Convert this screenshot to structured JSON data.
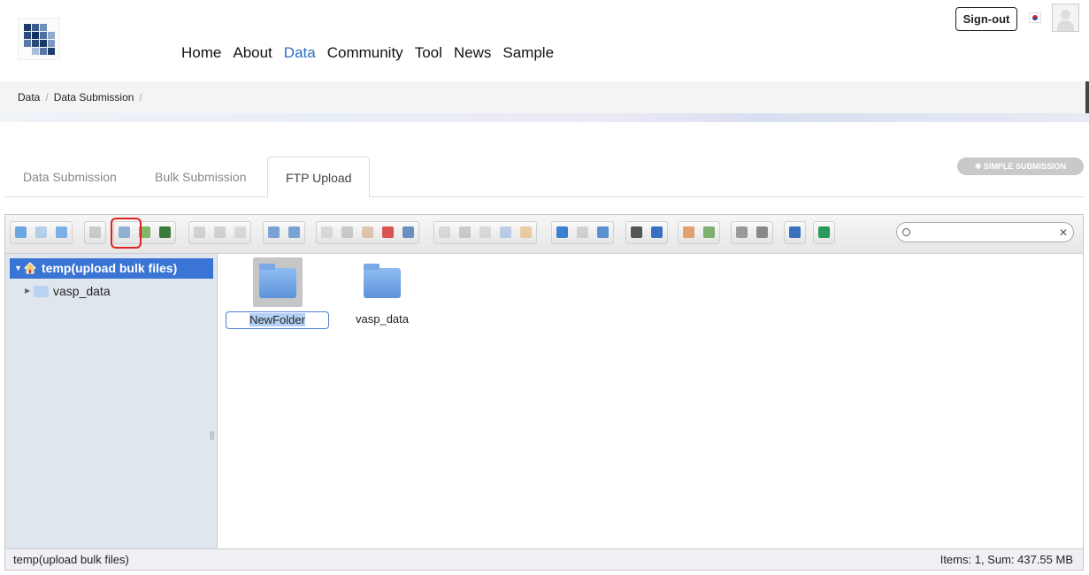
{
  "header": {
    "nav": [
      {
        "label": "Home",
        "active": false
      },
      {
        "label": "About",
        "active": false
      },
      {
        "label": "Data",
        "active": true
      },
      {
        "label": "Community",
        "active": false
      },
      {
        "label": "Tool",
        "active": false
      },
      {
        "label": "News",
        "active": false
      },
      {
        "label": "Sample",
        "active": false
      }
    ],
    "signout_label": "Sign-out"
  },
  "breadcrumb": [
    "Data",
    "Data Submission"
  ],
  "tabs": [
    "Data Submission",
    "Bulk Submission",
    "FTP Upload"
  ],
  "active_tab": "FTP Upload",
  "simple_submission_label": "SIMPLE SUBMISSION",
  "filemanager": {
    "tree_root": "temp(upload bulk files)",
    "tree_items": [
      "vasp_data"
    ],
    "files": [
      {
        "name": "NewFolder",
        "renaming": true
      },
      {
        "name": "vasp_data",
        "renaming": false
      }
    ],
    "status_path": "temp(upload bulk files)",
    "status_summary": "Items: 1, Sum: 437.55 MB",
    "search_value": ""
  },
  "colors": {
    "accent": "#3a74d4",
    "nav_active": "#2d6cc0",
    "highlight": "#e02020"
  },
  "toolbar_icons": [
    "back-icon",
    "forward-icon",
    "up-icon",
    "home-icon",
    "new-folder-icon",
    "upload-icon",
    "save-icon",
    "open-icon",
    "save-as-icon",
    "select-icon",
    "undo-icon",
    "redo-icon",
    "copy-icon",
    "cut-icon",
    "paste-icon",
    "delete-icon",
    "empty-icon",
    "duplicate-icon",
    "select-all-icon",
    "rename-icon",
    "extract-icon",
    "archive-icon",
    "icons-view-icon",
    "list-view-icon",
    "tile-view-icon",
    "preview-icon",
    "info-icon",
    "sort-icon",
    "resize-icon",
    "edit-icon",
    "compress-icon",
    "help-icon",
    "fullscreen-icon"
  ]
}
